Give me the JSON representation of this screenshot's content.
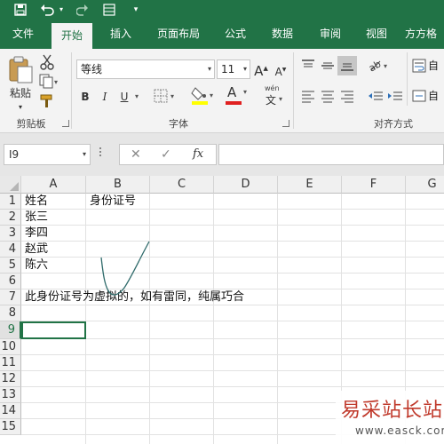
{
  "colors": {
    "brand": "#217346",
    "ribbon_bg": "#f3f3f3",
    "sheet_selection": "#217346"
  },
  "quick_access": {
    "save_icon": "save-icon",
    "undo_icon": "undo-icon",
    "form_icon": "form-icon",
    "customize_icon": "customize-icon"
  },
  "tabs": [
    "文件",
    "开始",
    "插入",
    "页面布局",
    "公式",
    "数据",
    "审阅",
    "视图",
    "方方格"
  ],
  "active_tab": "开始",
  "ribbon": {
    "clipboard": {
      "label": "剪贴板",
      "paste": "粘贴"
    },
    "font": {
      "label": "字体",
      "font_name": "等线",
      "font_size": "11",
      "bold": "B",
      "italic": "I",
      "underline": "U",
      "grow": "A",
      "shrink": "A",
      "font_color": "A",
      "wen": "wén",
      "wen_char": "文"
    },
    "alignment": {
      "label": "对齐方式",
      "wrap_label": "自"
    }
  },
  "formula_bar": {
    "name_box": "I9",
    "cancel": "✕",
    "enter": "✓",
    "fx": "fx",
    "formula": ""
  },
  "sheet": {
    "columns": [
      "A",
      "B",
      "C",
      "D",
      "E",
      "F",
      "G"
    ],
    "rows": [
      "1",
      "2",
      "3",
      "4",
      "5",
      "6",
      "7",
      "8",
      "9",
      "10",
      "11",
      "12",
      "13",
      "14",
      "15"
    ],
    "selected_row": "9",
    "cells": {
      "A1": "姓名",
      "B1": "身份证号",
      "A2": "张三",
      "A3": "李四",
      "A4": "赵武",
      "A5": "陈六",
      "A7": "此身份证号为虚拟的，如有雷同，纯属巧合"
    }
  },
  "watermark": {
    "title": "易采站长站",
    "url": "www.easck.com"
  }
}
